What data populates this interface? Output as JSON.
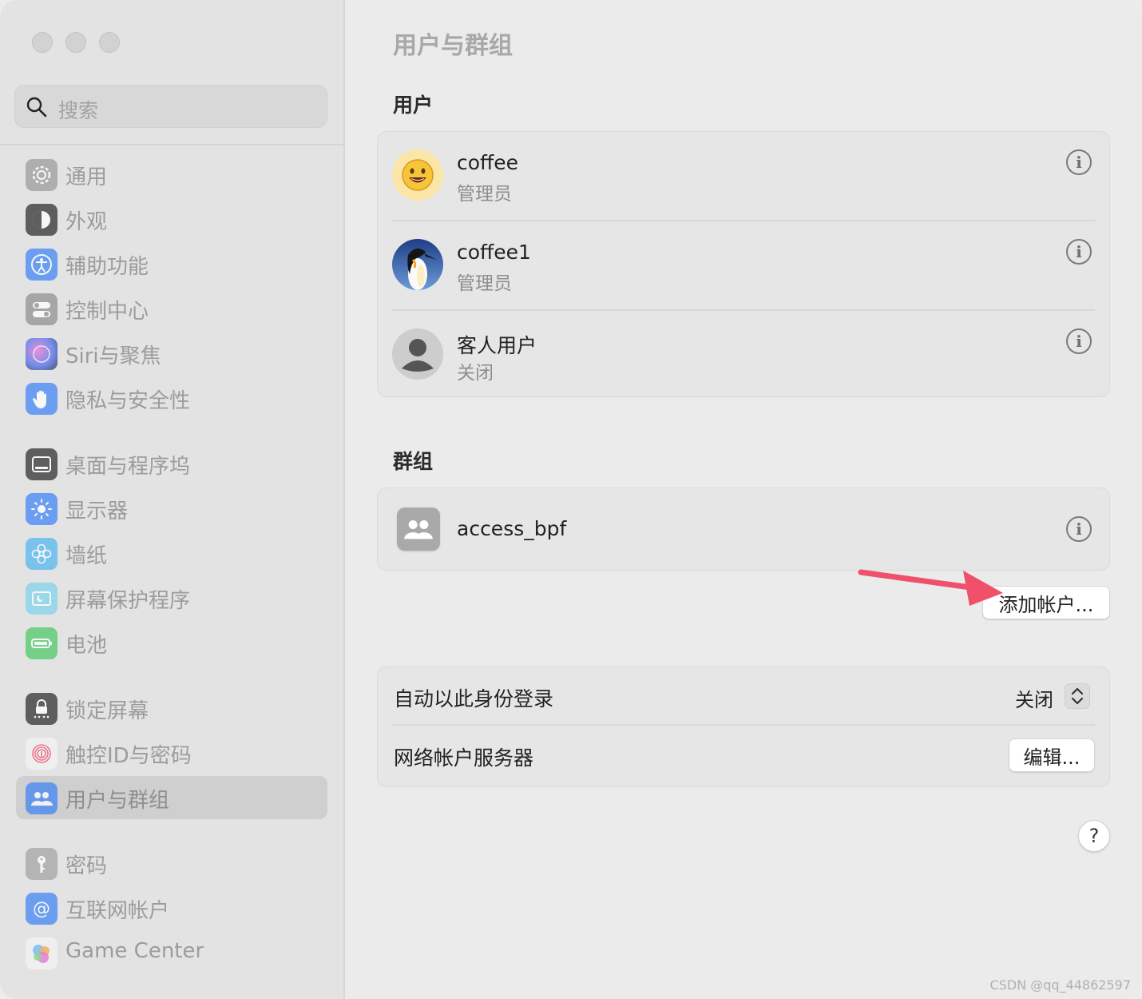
{
  "window": {
    "page_title": "用户与群组"
  },
  "sidebar": {
    "search_placeholder": "搜索",
    "items": [
      {
        "label": "通用",
        "icon": "gear-icon"
      },
      {
        "label": "外观",
        "icon": "appearance-icon"
      },
      {
        "label": "辅助功能",
        "icon": "accessibility-icon"
      },
      {
        "label": "控制中心",
        "icon": "control-center-icon"
      },
      {
        "label": "Siri与聚焦",
        "icon": "siri-icon"
      },
      {
        "label": "隐私与安全性",
        "icon": "hand-icon"
      },
      {
        "label": "桌面与程序坞",
        "icon": "dock-icon"
      },
      {
        "label": "显示器",
        "icon": "sun-icon"
      },
      {
        "label": "墙纸",
        "icon": "flower-icon"
      },
      {
        "label": "屏幕保护程序",
        "icon": "screensaver-icon"
      },
      {
        "label": "电池",
        "icon": "battery-icon"
      },
      {
        "label": "锁定屏幕",
        "icon": "lock-icon"
      },
      {
        "label": "触控ID与密码",
        "icon": "fingerprint-icon"
      },
      {
        "label": "用户与群组",
        "icon": "users-icon",
        "selected": true
      },
      {
        "label": "密码",
        "icon": "key-icon"
      },
      {
        "label": "互联网帐户",
        "icon": "at-icon"
      },
      {
        "label": "Game Center",
        "icon": "game-center-icon"
      }
    ]
  },
  "users_section": {
    "title": "用户",
    "users": [
      {
        "name": "coffee",
        "role": "管理员",
        "avatar": "smiley-avatar"
      },
      {
        "name": "coffee1",
        "role": "管理员",
        "avatar": "penguin-avatar"
      },
      {
        "name": "客人用户",
        "role": "关闭",
        "avatar": "guest-avatar"
      }
    ]
  },
  "groups_section": {
    "title": "群组",
    "groups": [
      {
        "name": "access_bpf",
        "icon": "group-icon"
      }
    ]
  },
  "add_account_label": "添加帐户...",
  "login_settings": {
    "auto_login_label": "自动以此身份登录",
    "auto_login_value": "关闭",
    "network_server_label": "网络帐户服务器",
    "edit_label": "编辑..."
  },
  "help_label": "?",
  "info_glyph": "i",
  "watermark": "CSDN @qq_44862597",
  "colors": {
    "arrow": "#f0506a",
    "accent": "#5a8cf0"
  }
}
